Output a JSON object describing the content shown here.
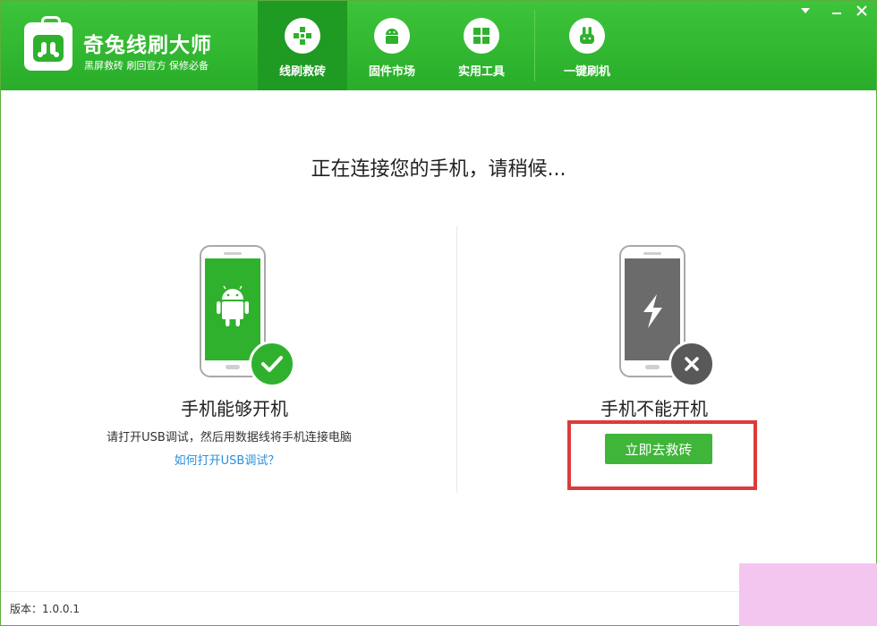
{
  "app": {
    "title": "奇兔线刷大师",
    "slogan": "黑屏救砖  刷回官方  保修必备"
  },
  "nav": {
    "items": [
      {
        "label": "线刷救砖",
        "icon": "plus-cross-icon",
        "active": true
      },
      {
        "label": "固件市场",
        "icon": "android-icon",
        "active": false
      },
      {
        "label": "实用工具",
        "icon": "windows-grid-icon",
        "active": false
      },
      {
        "label": "一键刷机",
        "icon": "rabbit-icon",
        "active": false
      }
    ]
  },
  "window_controls": [
    "chevron-down-icon",
    "minimize-icon",
    "close-icon"
  ],
  "main": {
    "heading": "正在连接您的手机，请稍候...",
    "left": {
      "title": "手机能够开机",
      "instruction": "请打开USB调试，然后用数据线将手机连接电脑",
      "link": "如何打开USB调试？",
      "phone_screen_color": "#2fb12e",
      "badge_color": "#2fb12e"
    },
    "right": {
      "title": "手机不能开机",
      "button": "立即去救砖",
      "phone_screen_color": "#6b6b6b",
      "badge_color": "#595959"
    }
  },
  "footer": {
    "version": "版本：1.0.0.1"
  },
  "colors": {
    "brand_green": "#2fb12e",
    "highlight_red": "#dc3b3b",
    "link_blue": "#2b8fd6"
  }
}
